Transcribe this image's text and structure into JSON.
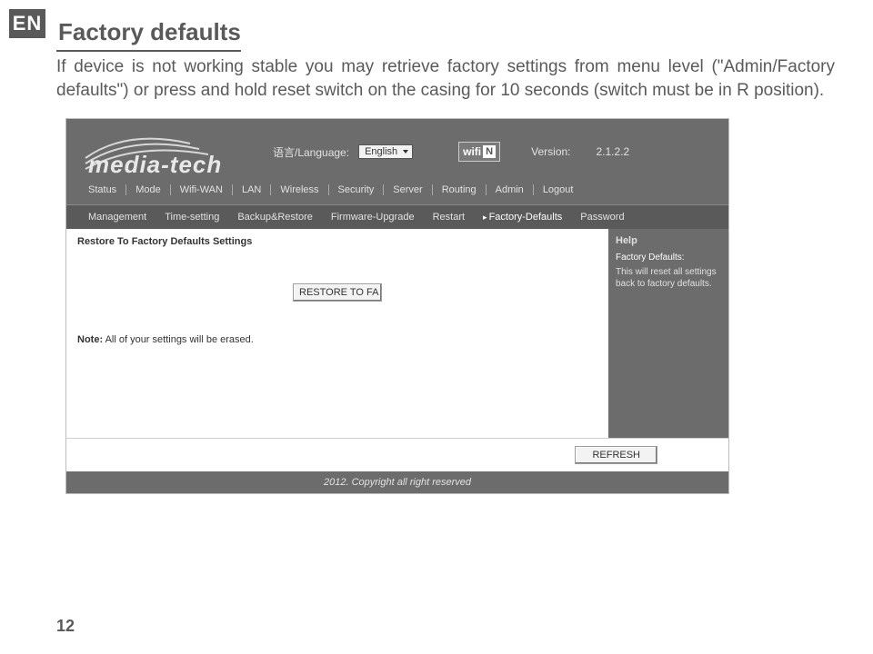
{
  "doc": {
    "lang_tab": "EN",
    "title": "Factory defaults",
    "paragraph": "If device is not working stable you may retrieve factory settings from menu level (\"Admin/Factory defaults\") or press and hold reset switch on the casing for 10 seconds (switch must be in R position).",
    "page_number": "12"
  },
  "router_ui": {
    "logo_text": "media-tech",
    "language_label": "语言/Language:",
    "language_value": "English",
    "wifi_badge": {
      "text": "wifi",
      "letter": "N"
    },
    "version_label": "Version:",
    "version_value": "2.1.2.2",
    "main_nav": [
      "Status",
      "Mode",
      "Wifi-WAN",
      "LAN",
      "Wireless",
      "Security",
      "Server",
      "Routing",
      "Admin",
      "Logout"
    ],
    "sub_nav": [
      {
        "label": "Management",
        "active": false
      },
      {
        "label": "Time-setting",
        "active": false
      },
      {
        "label": "Backup&Restore",
        "active": false
      },
      {
        "label": "Firmware-Upgrade",
        "active": false
      },
      {
        "label": "Restart",
        "active": false
      },
      {
        "label": "Factory-Defaults",
        "active": true
      },
      {
        "label": "Password",
        "active": false
      }
    ],
    "content": {
      "title": "Restore To Factory Defaults Settings",
      "restore_button": "RESTORE TO FA",
      "note_label": "Note:",
      "note_text": "All of your settings will be erased."
    },
    "help": {
      "title": "Help",
      "subtitle": "Factory Defaults:",
      "body": "This will reset all settings back to factory defaults."
    },
    "refresh_button": "REFRESH",
    "footer": "2012. Copyright all right reserved"
  }
}
